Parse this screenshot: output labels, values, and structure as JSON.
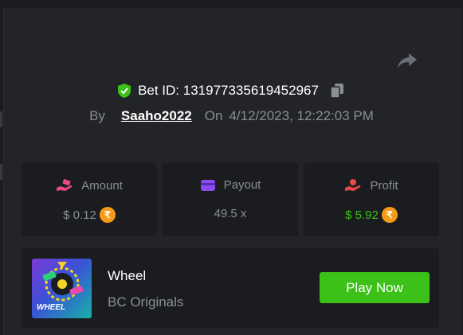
{
  "bet": {
    "id_label": "Bet ID: 131977335619452967",
    "by_label": "By",
    "username": "Saaho2022",
    "on_label": "On",
    "datetime": "4/12/2023, 12:22:03 PM"
  },
  "stats": {
    "amount": {
      "label": "Amount",
      "value": "$ 0.12",
      "currency_icon": "rupee-coin-icon",
      "icon": "money-hand-icon",
      "icon_color": "#e84a7f"
    },
    "payout": {
      "label": "Payout",
      "value": "49.5 x",
      "icon": "wallet-icon",
      "icon_color": "#8a4cf0"
    },
    "profit": {
      "label": "Profit",
      "value": "$ 5.92",
      "currency_icon": "rupee-coin-icon",
      "icon": "hand-coin-icon",
      "icon_color": "#e84a4a",
      "value_color": "#3bc117"
    }
  },
  "coin_symbol": "₹",
  "game": {
    "name": "Wheel",
    "provider": "BC Originals",
    "thumb_label": "WHEEL",
    "play_label": "Play Now"
  },
  "colors": {
    "accent_green": "#3bc117",
    "shield_green": "#3bc117",
    "coin": "#f59b1a",
    "text_muted": "#8a8d93"
  }
}
